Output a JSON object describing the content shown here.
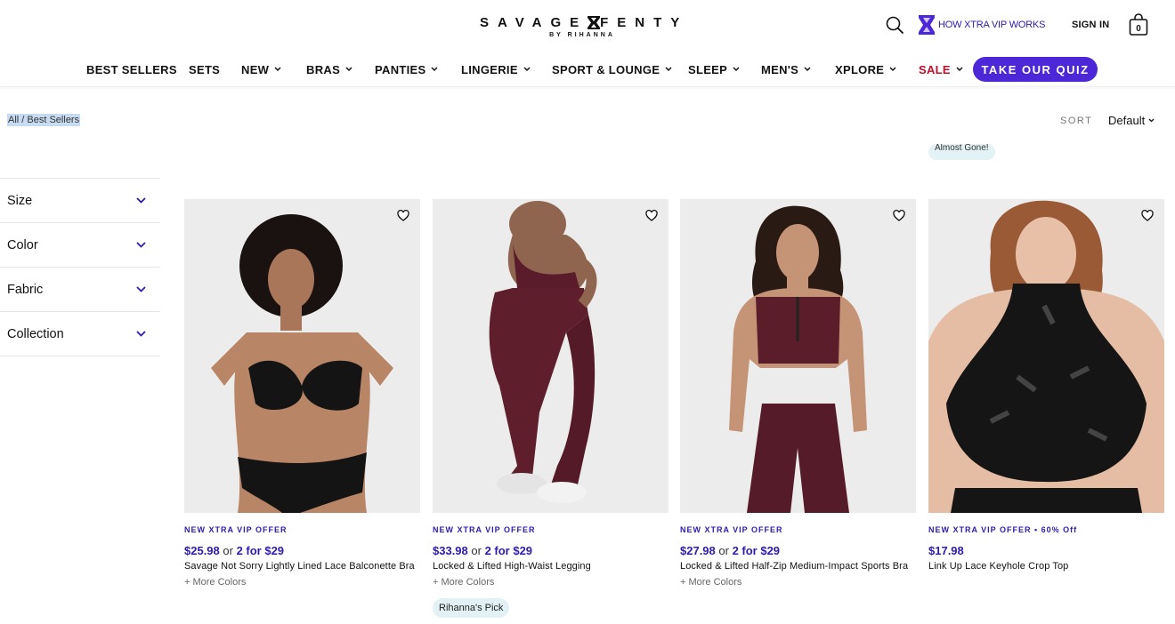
{
  "header": {
    "logo_left": "SAVAGE",
    "logo_right": "FENTY",
    "logo_sub": "BY RIHANNA",
    "vip_link": "HOW XTRA VIP WORKS",
    "signin": "SIGN IN",
    "bag_count": "0"
  },
  "nav": {
    "items": [
      {
        "label": "BEST SELLERS"
      },
      {
        "label": "SETS"
      },
      {
        "label": "NEW"
      },
      {
        "label": "BRAS"
      },
      {
        "label": "PANTIES"
      },
      {
        "label": "LINGERIE"
      },
      {
        "label": "SPORT & LOUNGE"
      },
      {
        "label": "SLEEP"
      },
      {
        "label": "MEN'S"
      },
      {
        "label": "XPLORE"
      },
      {
        "label": "SALE"
      }
    ],
    "quiz": "TAKE OUR QUIZ"
  },
  "breadcrumb": {
    "all": "All",
    "sep": " / ",
    "current": "Best Sellers"
  },
  "sort": {
    "label": "SORT",
    "value": "Default"
  },
  "almost_gone": "Almost Gone!",
  "filters": [
    {
      "label": "Size"
    },
    {
      "label": "Color"
    },
    {
      "label": "Fabric"
    },
    {
      "label": "Collection"
    }
  ],
  "products": [
    {
      "offer": "NEW XTRA VIP OFFER",
      "price": "$25.98",
      "or": " or ",
      "deal": "2 for $29",
      "name": "Savage Not Sorry Lightly Lined Lace Balconette Bra",
      "colors": "+ More Colors"
    },
    {
      "offer": "NEW XTRA VIP OFFER",
      "price": "$33.98",
      "or": " or ",
      "deal": "2 for $29",
      "name": "Locked & Lifted High-Waist Legging",
      "colors": "+ More Colors",
      "tag": "Rihanna's Pick"
    },
    {
      "offer": "NEW XTRA VIP OFFER",
      "price": "$27.98",
      "or": " or ",
      "deal": "2 for $29",
      "name": "Locked & Lifted Half-Zip Medium-Impact Sports Bra",
      "colors": "+ More Colors"
    },
    {
      "offer": "NEW XTRA VIP OFFER • 60% Off",
      "price": "$17.98",
      "name": "Link Up Lace Keyhole Crop Top"
    }
  ],
  "colors": {
    "brand_purple": "#4b27d8",
    "link_blue": "#2d1bb3",
    "sale_red": "#c0102a"
  }
}
